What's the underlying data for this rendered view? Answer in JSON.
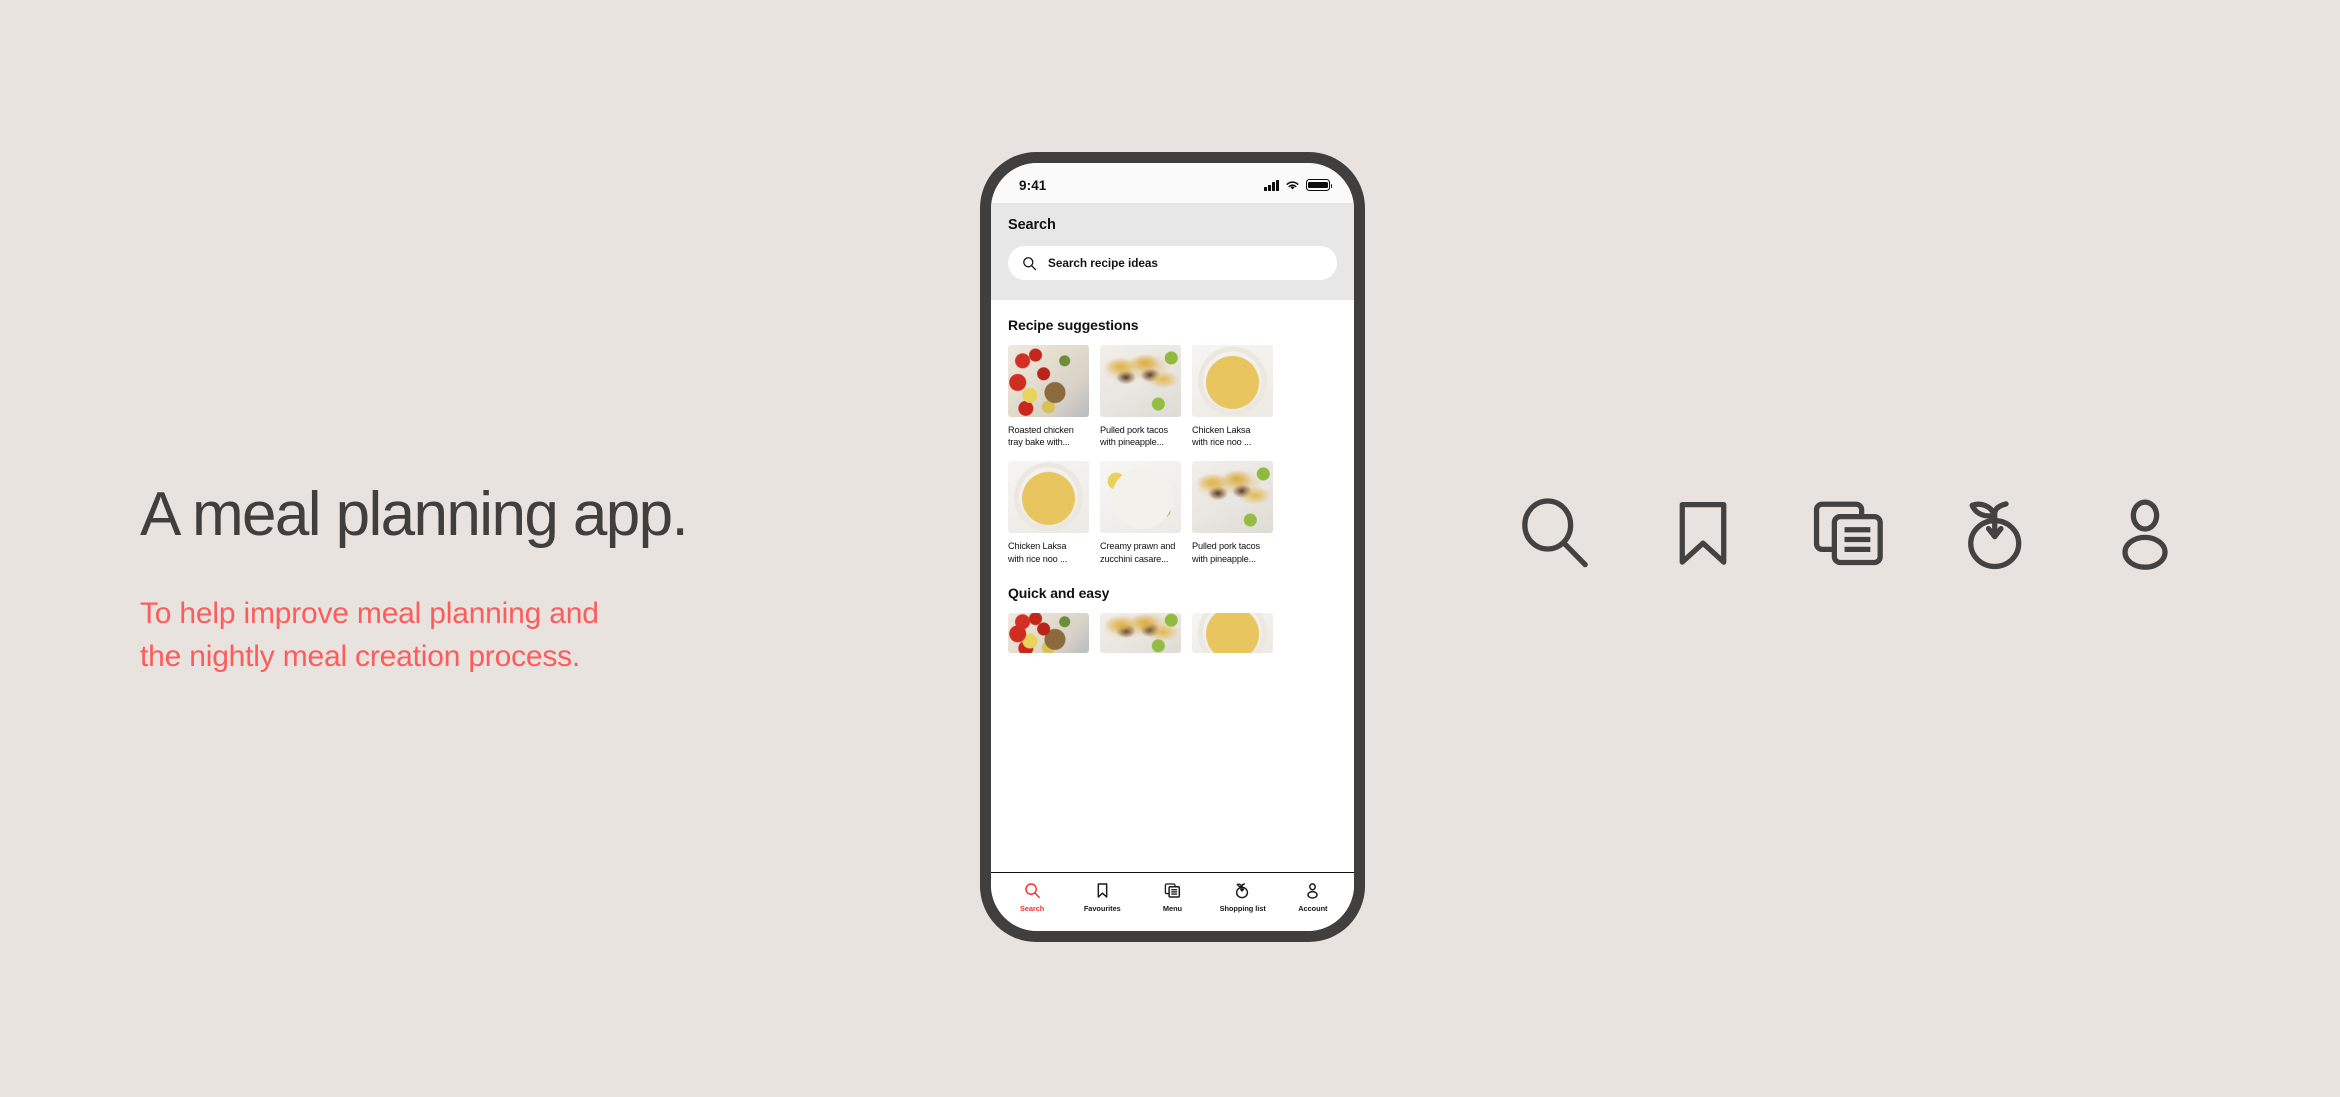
{
  "page": {
    "background_color": "#e8e3df"
  },
  "copy": {
    "headline": "A meal planning app.",
    "headline_color": "#403f3d",
    "subhead_line1": "To help improve meal planning and",
    "subhead_line2": "the nightly meal creation process.",
    "subhead_color": "#fc5c5c"
  },
  "phone": {
    "frame_color": "#403f3d",
    "status_bar": {
      "time": "9:41",
      "signal_icon": "cellular-signal-icon",
      "wifi_icon": "wifi-icon",
      "battery_icon": "battery-icon"
    },
    "search_header": {
      "title": "Search",
      "search_icon": "search-icon",
      "placeholder": "Search recipe ideas",
      "value": ""
    },
    "sections": [
      {
        "title": "Recipe suggestions",
        "rows": [
          {
            "cards": [
              {
                "line1": "Roasted chicken",
                "line2": "tray bake with...",
                "image": "food-tray"
              },
              {
                "line1": "Pulled pork tacos",
                "line2": "with pineapple...",
                "image": "food-tacos"
              },
              {
                "line1": "Chicken Laksa",
                "line2": "with rice noo ...",
                "image": "food-laksa"
              }
            ]
          },
          {
            "cards": [
              {
                "line1": "Chicken Laksa",
                "line2": "with rice noo ...",
                "image": "food-laksa"
              },
              {
                "line1": "Creamy prawn and",
                "line2": "zucchini casare...",
                "image": "food-prawn"
              },
              {
                "line1": "Pulled pork tacos",
                "line2": "with pineapple...",
                "image": "food-tacos"
              }
            ]
          }
        ]
      },
      {
        "title": "Quick and easy",
        "rows": [
          {
            "cards": [
              {
                "line1": "",
                "line2": "",
                "image": "food-tray"
              },
              {
                "line1": "",
                "line2": "",
                "image": "food-tacos"
              },
              {
                "line1": "",
                "line2": "",
                "image": "food-laksa"
              }
            ]
          }
        ]
      }
    ],
    "tab_bar": {
      "active_color": "#f43030",
      "inactive_color": "#1a1a1a",
      "tabs": [
        {
          "label": "Search",
          "icon": "search-icon",
          "active": true
        },
        {
          "label": "Favourites",
          "icon": "bookmark-icon",
          "active": false
        },
        {
          "label": "Menu",
          "icon": "documents-icon",
          "active": false
        },
        {
          "label": "Shopping list",
          "icon": "fruit-icon",
          "active": false
        },
        {
          "label": "Account",
          "icon": "person-icon",
          "active": false
        }
      ]
    }
  },
  "icon_strip": {
    "color": "#434240",
    "icons": [
      {
        "name": "search-icon"
      },
      {
        "name": "bookmark-icon"
      },
      {
        "name": "documents-icon"
      },
      {
        "name": "fruit-icon"
      },
      {
        "name": "person-icon"
      }
    ]
  }
}
